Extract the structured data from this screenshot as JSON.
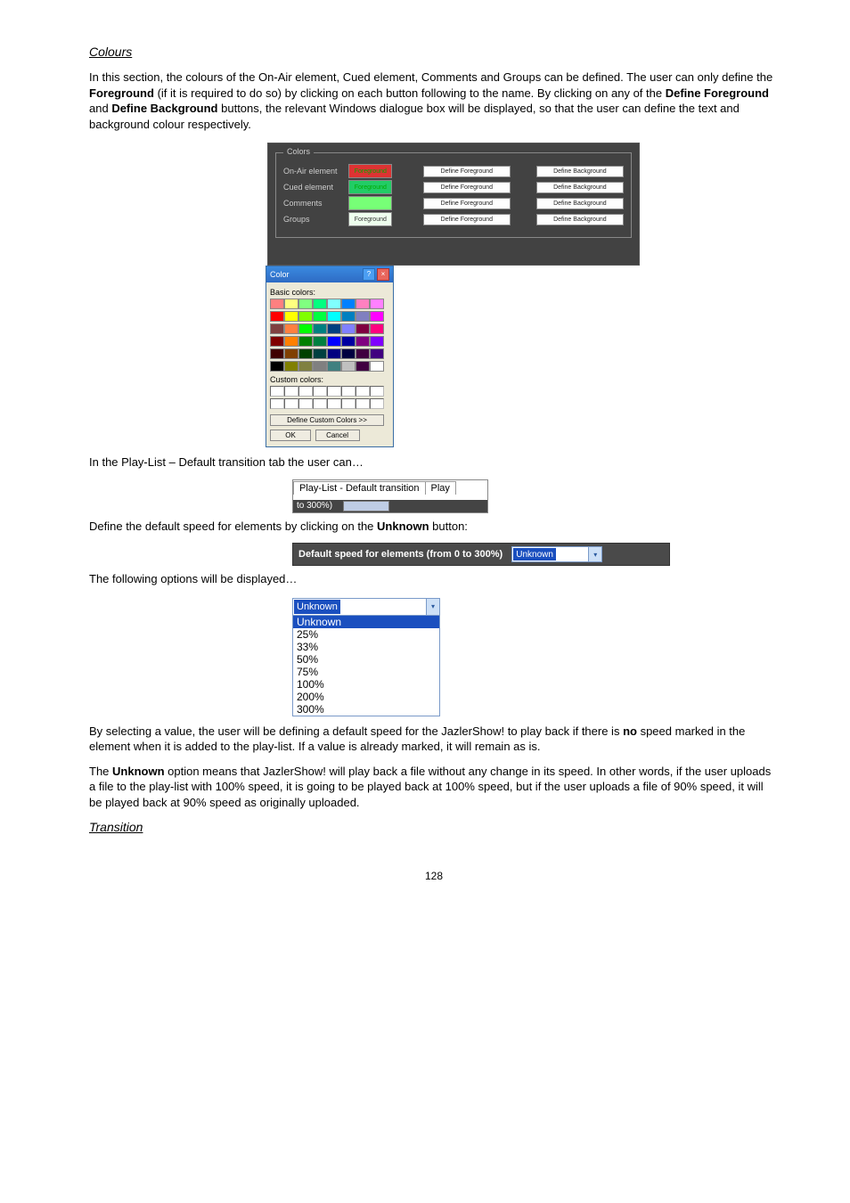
{
  "page_number": "128",
  "paragraphs": {
    "colours_title": "Colours",
    "p1a": "In this section, the colours of the On-Air element, Cued element, Comments and Groups can be defined. The user can only define the ",
    "p1_fore": "Foreground",
    "p1b": " (if it is required to do so) by clicking on each button following to the name. By clicking on any of the ",
    "p1_definefore": "Define Foreground",
    "p1c": " and ",
    "p1_defineback": "Define Background",
    "p1d": " buttons, the relevant Windows dialogue box will be displayed, so that the user can define the text and background colour respectively.",
    "p2": "In the Play-List – Default transition tab the user can…",
    "p3a": "Define the default speed for elements by clicking on the ",
    "p3_unknown": "Unknown",
    "p3b": " button:",
    "p4": "The following options will be displayed…",
    "p5a": "By selecting a value, the user will be defining a default speed for the JazlerShow! to play back if there is ",
    "p5_no": "no",
    "p5b": " speed marked in the element when it is added to the play-list. If a value is already marked, it will remain as is.",
    "p6a": "The ",
    "p6_unknown": "Unknown",
    "p6b": " option means that JazlerShow! will play back a file without any change in its speed. In other words, if the user uploads a file to the play-list with 100% speed, it is going to be played back at 100% speed, but if the user uploads a file of 90% speed, it will be played back at 90% speed as originally uploaded.",
    "transition_title": "Transition"
  },
  "colors_panel": {
    "legend": "Colors",
    "rows": [
      {
        "label": "On-Air element",
        "swatch": "Foreground",
        "swatch_class": "sw-red"
      },
      {
        "label": "Cued element",
        "swatch": "Foreground",
        "swatch_class": "sw-green"
      },
      {
        "label": "Comments",
        "swatch": "",
        "swatch_class": "sw-lgreen"
      },
      {
        "label": "Groups",
        "swatch": "Foreground",
        "swatch_class": "sw-white"
      }
    ],
    "btn_define_fore": "Define Foreground",
    "btn_define_back": "Define Background"
  },
  "color_dialog": {
    "title": "Color",
    "basic_label": "Basic colors:",
    "custom_label": "Custom colors:",
    "define_custom": "Define Custom Colors >>",
    "ok": "OK",
    "cancel": "Cancel",
    "basic_colors": [
      "#ff8080",
      "#ffff80",
      "#80ff80",
      "#00ff80",
      "#80ffff",
      "#0080ff",
      "#ff80c0",
      "#ff80ff",
      "#ff0000",
      "#ffff00",
      "#80ff00",
      "#00ff40",
      "#00ffff",
      "#0080c0",
      "#8080c0",
      "#ff00ff",
      "#804040",
      "#ff8040",
      "#00ff00",
      "#008080",
      "#004080",
      "#8080ff",
      "#800040",
      "#ff0080",
      "#800000",
      "#ff8000",
      "#008000",
      "#008040",
      "#0000ff",
      "#0000a0",
      "#800080",
      "#8000ff",
      "#400000",
      "#804000",
      "#004000",
      "#004040",
      "#000080",
      "#000040",
      "#400040",
      "#400080",
      "#000000",
      "#808000",
      "#808040",
      "#808080",
      "#408080",
      "#c0c0c0",
      "#400040",
      "#ffffff"
    ]
  },
  "fig_tab": {
    "tab1": "Play-List - Default transition",
    "tab2": "Play",
    "bottom_text": "to 300%)"
  },
  "fig_speed": {
    "label": "Default speed for elements (from 0 to 300%)",
    "selected": "Unknown"
  },
  "dropdown": {
    "selected": "Unknown",
    "options": [
      "Unknown",
      "25%",
      "33%",
      "50%",
      "75%",
      "100%",
      "200%",
      "300%"
    ]
  }
}
